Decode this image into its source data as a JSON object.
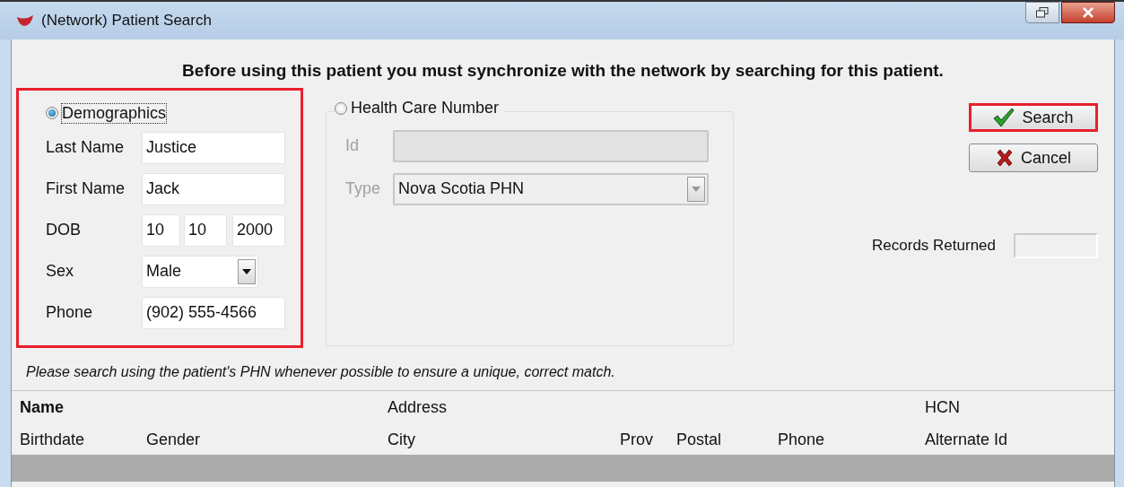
{
  "window": {
    "title": "(Network) Patient Search"
  },
  "instruction": "Before using this patient you must synchronize with the network by searching for this patient.",
  "demographics": {
    "label": "Demographics",
    "selected": true,
    "highlighted": true,
    "fields": [
      {
        "kind": "text",
        "label": "Last Name",
        "value": "Justice"
      },
      {
        "kind": "text",
        "label": "First Name",
        "value": "Jack"
      },
      {
        "kind": "date",
        "label": "DOB",
        "values": [
          "10",
          "10",
          "2000"
        ]
      },
      {
        "kind": "combo",
        "label": "Sex",
        "value": "Male"
      },
      {
        "kind": "text",
        "label": "Phone",
        "value": "(902) 555-4566"
      }
    ]
  },
  "health_care_number": {
    "label": "Health Care Number",
    "selected": false,
    "disabled": true,
    "fields": [
      {
        "kind": "text",
        "label": "Id"
      },
      {
        "kind": "combo",
        "label": "Type",
        "value": "Nova Scotia PHN"
      }
    ]
  },
  "buttons": [
    {
      "kind": "search",
      "label": "Search",
      "highlighted": true
    },
    {
      "kind": "cancel",
      "label": "Cancel",
      "highlighted": false
    }
  ],
  "records_returned": {
    "label": "Records Returned"
  },
  "hint": "Please search using the patient's PHN whenever possible to ensure a unique, correct match.",
  "results": {
    "header_rows": [
      [
        "Name",
        "Address",
        "HCN"
      ],
      [
        "Birthdate",
        "Gender",
        "City",
        "Prov",
        "Postal",
        "Phone",
        "Alternate Id"
      ]
    ]
  }
}
